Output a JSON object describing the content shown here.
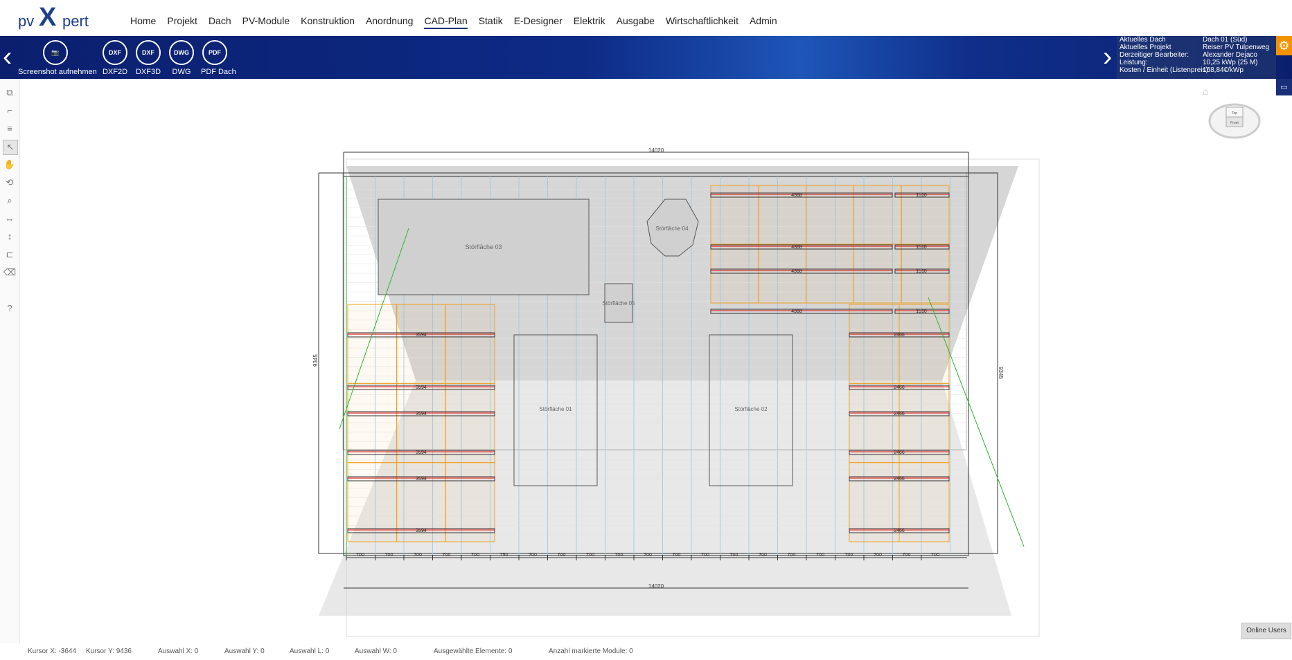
{
  "logo": {
    "pv": "pv",
    "x": "X",
    "pert": "pert"
  },
  "menu": [
    "Home",
    "Projekt",
    "Dach",
    "PV-Module",
    "Konstruktion",
    "Anordnung",
    "CAD-Plan",
    "Statik",
    "E-Designer",
    "Elektrik",
    "Ausgabe",
    "Wirtschaftlichkeit",
    "Admin"
  ],
  "menu_active": "CAD-Plan",
  "ribbon": {
    "buttons": [
      {
        "label": "Screenshot aufnehmen",
        "icon": "camera-icon",
        "glyph": "📷"
      },
      {
        "label": "DXF2D",
        "icon": "dxf2d-file-icon",
        "glyph": "DXF"
      },
      {
        "label": "DXF3D",
        "icon": "dxf3d-file-icon",
        "glyph": "DXF"
      },
      {
        "label": "DWG",
        "icon": "dwg-file-icon",
        "glyph": "DWG"
      },
      {
        "label": "PDF Dach",
        "icon": "pdf-file-icon",
        "glyph": "PDF"
      }
    ]
  },
  "info": {
    "labels": [
      "Aktuelles Dach",
      "Aktuelles Projekt",
      "Derzeitiger Bearbeiter:",
      "Leistung:",
      "Kosten / Einheit (Listenpreis):"
    ],
    "values": [
      "Dach 01 (Süd)",
      "Reiser PV Tulpenweg",
      "Alexander Dejaco",
      "10,25 kWp (25 M)",
      "168,84€/kWp"
    ]
  },
  "status": {
    "kursor_x": "Kursor X:  -3644",
    "kursor_y": "Kursor Y:  9436",
    "auswahl_x": "Auswahl X:  0",
    "auswahl_y": "Auswahl Y:  0",
    "auswahl_l": "Auswahl L:  0",
    "auswahl_w": "Auswahl W:  0",
    "ausgewaehlte": "Ausgewählte Elemente:  0",
    "markierte": "Anzahl markierte Module:  0"
  },
  "online_users": "Online Users",
  "cad": {
    "dim_top": "14020",
    "dim_bottom": "14020",
    "dim_left": "9345",
    "dim_right": "9345",
    "bottom_spacing": [
      "700",
      "700",
      "700",
      "700",
      "700",
      "750",
      "700",
      "700",
      "700",
      "700",
      "700",
      "700",
      "700",
      "700",
      "700",
      "700",
      "700",
      "700",
      "700",
      "700",
      "700"
    ],
    "obstacles": [
      "Störfläche 03",
      "Störfläche 04",
      "Störfläche 05",
      "Störfläche 01",
      "Störfläche 02"
    ],
    "rail_labels_right": [
      "4368",
      "1510",
      "4368",
      "1510",
      "4368",
      "1510",
      "4368",
      "1510"
    ],
    "rail_labels_left": [
      "3594",
      "3594",
      "3594",
      "3594",
      "3594",
      "3594"
    ],
    "rail_labels_right_lower": [
      "2466",
      "2466",
      "2466",
      "2466",
      "2466",
      "2466"
    ]
  },
  "colors": {
    "ribbon": "#0d2a85",
    "accent": "#f39200",
    "module": "#f0a020",
    "rail": "#e03030",
    "grid": "#8fc7e8"
  }
}
